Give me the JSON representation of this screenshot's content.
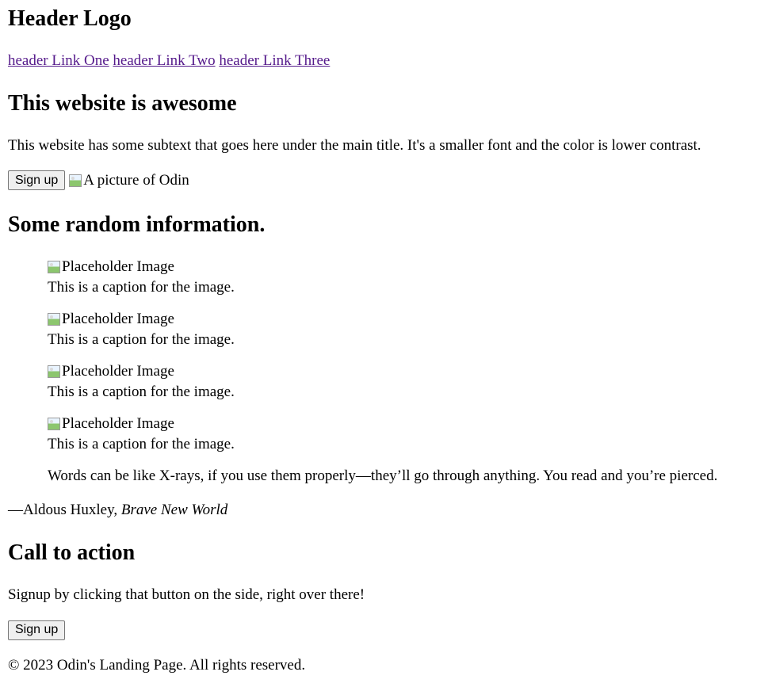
{
  "header": {
    "logo": "Header Logo",
    "links": [
      "header Link One",
      "header Link Two",
      "header Link Three"
    ]
  },
  "hero": {
    "title": "This website is awesome",
    "subtext": "This website has some subtext that goes here under the main title. It's a smaller font and the color is lower contrast.",
    "button_label": "Sign up",
    "image_alt": "A picture of Odin"
  },
  "info": {
    "title": "Some random information.",
    "items": [
      {
        "image_alt": "Placeholder Image",
        "caption": "This is a caption for the image."
      },
      {
        "image_alt": "Placeholder Image",
        "caption": "This is a caption for the image."
      },
      {
        "image_alt": "Placeholder Image",
        "caption": "This is a caption for the image."
      },
      {
        "image_alt": "Placeholder Image",
        "caption": "This is a caption for the image."
      }
    ]
  },
  "quote": {
    "text": "Words can be like X-rays, if you use them properly—they’ll go through anything. You read and you’re pierced.",
    "author": "—Aldous Huxley, ",
    "source": "Brave New World"
  },
  "cta": {
    "title": "Call to action",
    "text": "Signup by clicking that button on the side, right over there!",
    "button_label": "Sign up"
  },
  "footer": {
    "text": "© 2023 Odin's Landing Page. All rights reserved."
  },
  "colors": {
    "link": "#551a8b",
    "button_bg": "#efefef",
    "button_border": "#767676"
  }
}
